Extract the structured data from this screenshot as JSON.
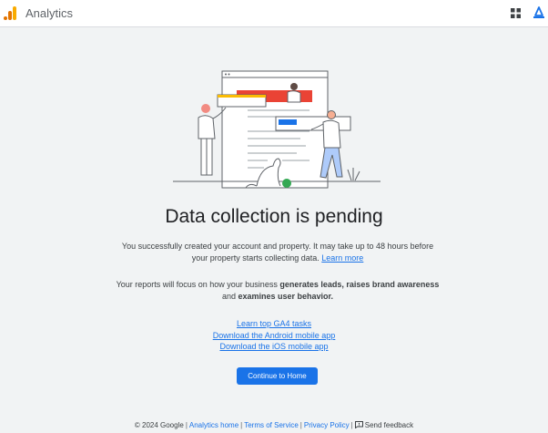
{
  "header": {
    "app_name": "Analytics",
    "logo_icon": "analytics-logo-icon",
    "apps_icon": "apps-grid-icon",
    "account_icon": "account-icon",
    "brand_colors": {
      "logo_orange": "#f9ab00",
      "logo_dark": "#e37400",
      "accent": "#1a73e8"
    }
  },
  "main": {
    "headline": "Data collection is pending",
    "intro_text": "You successfully created your account and property. It may take up to 48 hours before your property starts collecting data.",
    "learn_more": "Learn more",
    "focus_before": "Your reports will focus on how your business ",
    "focus_bold1": "generates leads, raises brand awareness",
    "focus_middle": " and ",
    "focus_bold2": "examines user behavior.",
    "links": [
      "Learn top GA4 tasks",
      "Download the Android mobile app",
      "Download the iOS mobile app"
    ],
    "cta_label": "Continue to Home"
  },
  "footer": {
    "copyright": "© 2024 Google",
    "links": [
      "Analytics home",
      "Terms of Service",
      "Privacy Policy"
    ],
    "feedback": "Send feedback",
    "feedback_icon": "feedback-icon"
  }
}
